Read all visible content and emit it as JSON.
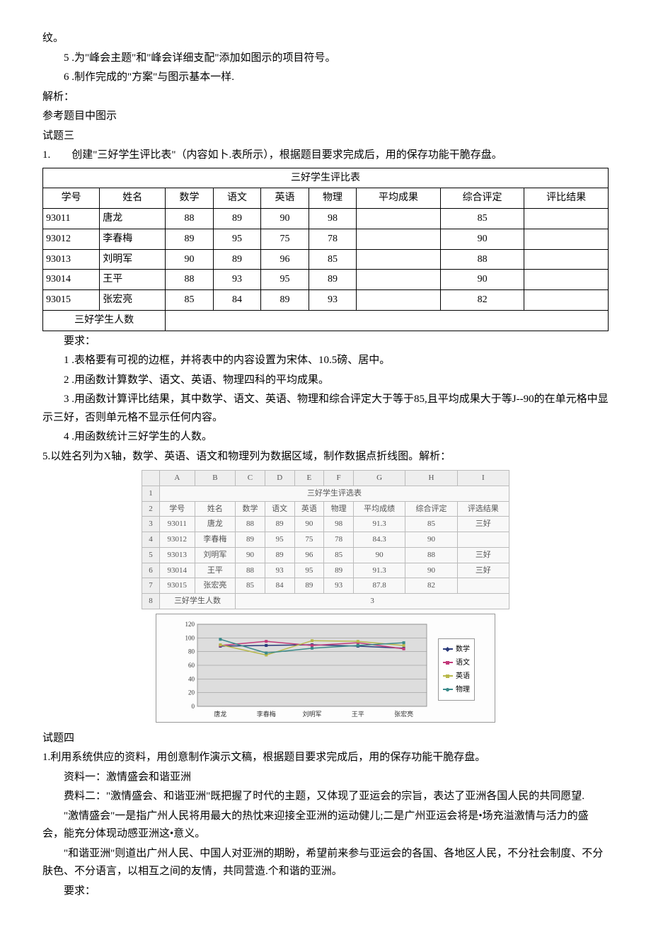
{
  "intro": {
    "wen": "纹。",
    "item5": "5 .为\"峰会主题\"和\"峰会详细支配\"添加如图示的项目符号。",
    "item6": "6 .制作完成的\"方案\"与图示基本一样.",
    "jiexi": "解析：",
    "cantu": "参考题目中图示"
  },
  "q3": {
    "title": "试题三",
    "prompt": "1.　　创建\"三好学生评比表\"（内容如卜.表所示），根据题目要求完成后，用的保存功能干脆存盘。",
    "table_title": "三好学生评比表",
    "headers": [
      "学号",
      "姓名",
      "数学",
      "语文",
      "英语",
      "物理",
      "平均成果",
      "综合评定",
      "评比结果"
    ],
    "rows": [
      {
        "id": "93011",
        "name": "唐龙",
        "math": "88",
        "chinese": "89",
        "english": "90",
        "physics": "98",
        "avg": "",
        "zh": "85",
        "res": ""
      },
      {
        "id": "93012",
        "name": "李春梅",
        "math": "89",
        "chinese": "95",
        "english": "75",
        "physics": "78",
        "avg": "",
        "zh": "90",
        "res": ""
      },
      {
        "id": "93013",
        "name": "刘明军",
        "math": "90",
        "chinese": "89",
        "english": "96",
        "physics": "85",
        "avg": "",
        "zh": "88",
        "res": ""
      },
      {
        "id": "93014",
        "name": "王平",
        "math": "88",
        "chinese": "93",
        "english": "95",
        "physics": "89",
        "avg": "",
        "zh": "90",
        "res": ""
      },
      {
        "id": "93015",
        "name": "张宏亮",
        "math": "85",
        "chinese": "84",
        "english": "89",
        "physics": "93",
        "avg": "",
        "zh": "82",
        "res": ""
      }
    ],
    "count_label": "三好学生人数",
    "req_label": "要求：",
    "req1": "1 .表格要有可视的边框，并将表中的内容设置为宋体、10.5磅、居中。",
    "req2": "2 .用函数计算数学、语文、英语、物理四科的平均成果。",
    "req3": "3 .用函数计算评比结果，其中数学、语文、英语、物理和综合评定大于等于85,且平均成果大于等J--90的在单元格中显示三好，否则单元格不显示任何内容。",
    "req4": "4 .用函数统计三好学生的人数。",
    "req5": "5.以姓名列为X轴，数学、英语、语文和物理列为数据区域，制作数据点折线图。解析："
  },
  "result_table": {
    "cols": [
      "A",
      "B",
      "C",
      "D",
      "E",
      "F",
      "G",
      "H",
      "I"
    ],
    "title": "三好学生评选表",
    "headers": [
      "学号",
      "姓名",
      "数学",
      "语文",
      "英语",
      "物理",
      "平均成绩",
      "综合评定",
      "评选结果"
    ],
    "rows": [
      [
        "93011",
        "唐龙",
        "88",
        "89",
        "90",
        "98",
        "91.3",
        "85",
        "三好"
      ],
      [
        "93012",
        "李春梅",
        "89",
        "95",
        "75",
        "78",
        "84.3",
        "90",
        ""
      ],
      [
        "93013",
        "刘明军",
        "90",
        "89",
        "96",
        "85",
        "90",
        "88",
        "三好"
      ],
      [
        "93014",
        "王平",
        "88",
        "93",
        "95",
        "89",
        "91.3",
        "90",
        "三好"
      ],
      [
        "93015",
        "张宏亮",
        "85",
        "84",
        "89",
        "93",
        "87.8",
        "82",
        ""
      ]
    ],
    "count_label": "三好学生人数",
    "count_value": "3"
  },
  "chart_data": {
    "type": "line",
    "categories": [
      "唐龙",
      "李春梅",
      "刘明军",
      "王平",
      "张宏亮"
    ],
    "series": [
      {
        "name": "数学",
        "values": [
          88,
          89,
          90,
          88,
          85
        ],
        "color": "#2a3a7a"
      },
      {
        "name": "语文",
        "values": [
          89,
          95,
          89,
          93,
          84
        ],
        "color": "#c23a7a"
      },
      {
        "name": "英语",
        "values": [
          90,
          75,
          96,
          95,
          89
        ],
        "color": "#b8b84a"
      },
      {
        "name": "物理",
        "values": [
          98,
          78,
          85,
          89,
          93
        ],
        "color": "#3a8a8a"
      }
    ],
    "ylim": [
      0,
      120
    ],
    "yticks": [
      0,
      20,
      40,
      60,
      80,
      100,
      120
    ]
  },
  "q4": {
    "title": "试题四",
    "prompt": "1.利用系统供应的资料，用创意制作演示文稿，根据题目要求完成后，用的保存功能干脆存盘。",
    "m1": "资料一：激情盛会和谐亚洲",
    "m2": "费料二：\"激情盛会、和谐亚洲\"既把握了时代的主题，又体现了亚运会的宗旨，表达了亚洲各国人民的共同愿望.",
    "m3": "\"激情盛会\"一是指广州人民将用最大的热忱来迎接全亚洲的运动健儿;二是广州亚运会将是•场充溢激情与活力的盛会，能充分体现动感亚洲这•意义。",
    "m4": "\"和谐亚洲\"则道出广州人民、中国人对亚洲的期盼，希望前来参与亚运会的各国、各地区人民，不分社会制度、不分肤色、不分语言，以相互之间的友情，共同营造.个和谐的亚洲。",
    "req_label": "要求："
  }
}
